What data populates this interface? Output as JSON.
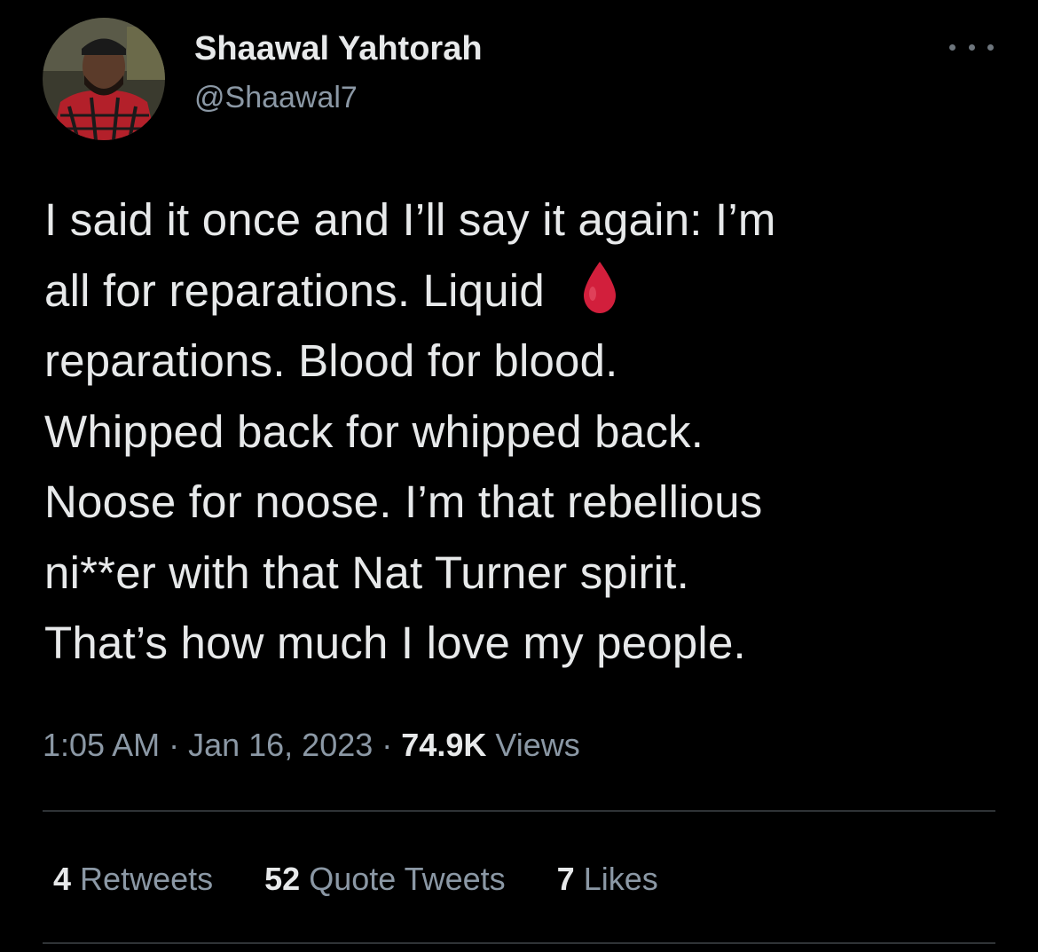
{
  "author": {
    "display_name": "Shaawal Yahtorah",
    "handle": "@Shaawal7",
    "avatar_icon": "profile-photo"
  },
  "more_icon": "more-dots-icon",
  "tweet": {
    "lines": [
      "I said it once and I’ll say it again: I’m",
      "all for reparations. Liquid",
      "reparations. Blood for blood.",
      "Whipped back for whipped back.",
      "Noose for noose. I’m that rebellious",
      "ni**er with that Nat Turner spirit.",
      "That’s how much I love my people."
    ],
    "emoji": "drop-of-blood-emoji",
    "emoji_color": "#d21f3c"
  },
  "meta": {
    "time": "1:05 AM",
    "separator": "·",
    "date": "Jan 16, 2023",
    "views_count": "74.9K",
    "views_label": "Views"
  },
  "stats": {
    "retweets_count": "4",
    "retweets_label": "Retweets",
    "quotes_count": "52",
    "quotes_label": "Quote Tweets",
    "likes_count": "7",
    "likes_label": "Likes"
  },
  "colors": {
    "background": "#000000",
    "primary_text": "#e7e9ea",
    "secondary_text": "#8b98a5",
    "divider": "#2f3336"
  }
}
